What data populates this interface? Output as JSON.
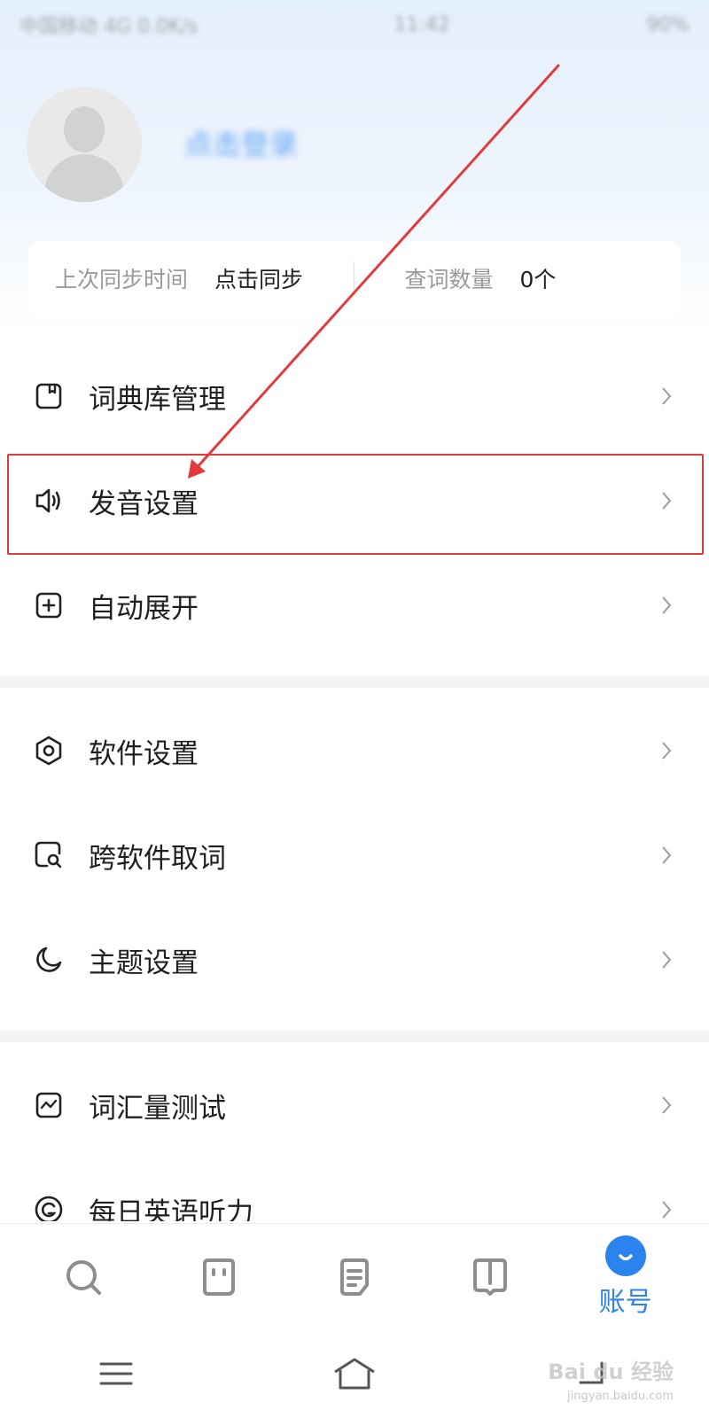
{
  "status_bar": {
    "left": "中国移动 4G 0.0K/s",
    "time": "11:42",
    "right": "90%"
  },
  "profile": {
    "username": "点击登录"
  },
  "sync_card": {
    "last_sync_label": "上次同步时间",
    "last_sync_value": "点击同步",
    "lookup_count_label": "查词数量",
    "lookup_count_value": "0个"
  },
  "menu_group_1": [
    {
      "label": "词典库管理",
      "icon": "book-icon"
    },
    {
      "label": "发音设置",
      "icon": "speaker-icon"
    },
    {
      "label": "自动展开",
      "icon": "plus-square-icon"
    }
  ],
  "menu_group_2": [
    {
      "label": "软件设置",
      "icon": "hex-gear-icon"
    },
    {
      "label": "跨软件取词",
      "icon": "search-window-icon"
    },
    {
      "label": "主题设置",
      "icon": "moon-icon"
    }
  ],
  "menu_group_3": [
    {
      "label": "词汇量测试",
      "icon": "trend-icon"
    },
    {
      "label": "每日英语听力",
      "icon": "headphone-icon"
    }
  ],
  "tabs": {
    "active_label": "账号"
  },
  "watermark": {
    "brand": "Bai du 经验",
    "url": "jingyan.baidu.com"
  },
  "colors": {
    "accent": "#2b84ee",
    "highlight": "#e23a3a"
  }
}
